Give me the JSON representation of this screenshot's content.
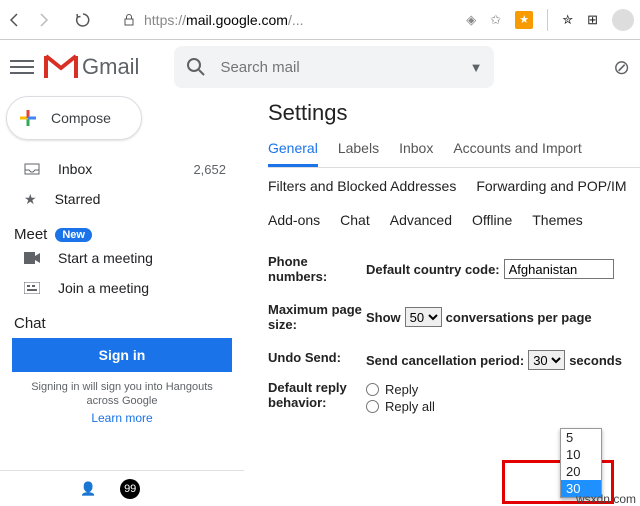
{
  "browser": {
    "url_prefix": "https://",
    "url_main": "mail.google.com",
    "url_suffix": "/..."
  },
  "header": {
    "logo": "Gmail",
    "search_placeholder": "Search mail"
  },
  "compose": {
    "label": "Compose"
  },
  "nav": {
    "inbox": "Inbox",
    "inbox_count": "2,652",
    "starred": "Starred"
  },
  "meet": {
    "title": "Meet",
    "badge": "New",
    "start": "Start a meeting",
    "join": "Join a meeting"
  },
  "chat": {
    "title": "Chat",
    "signin": "Sign in",
    "hint": "Signing in will sign you into Hangouts across Google",
    "learn": "Learn more"
  },
  "settings": {
    "title": "Settings",
    "tabs1": {
      "general": "General",
      "labels": "Labels",
      "inbox": "Inbox",
      "accounts": "Accounts and Import"
    },
    "tabs2": {
      "filters": "Filters and Blocked Addresses",
      "fwd": "Forwarding and POP/IM"
    },
    "tabs3": {
      "addons": "Add-ons",
      "chat": "Chat",
      "adv": "Advanced",
      "offline": "Offline",
      "themes": "Themes"
    },
    "phone": {
      "label": "Phone numbers:",
      "pre": "Default country code:",
      "value": "Afghanistan"
    },
    "page": {
      "label": "Maximum page size:",
      "pre": "Show",
      "value": "50",
      "post": "conversations per page"
    },
    "undo": {
      "label": "Undo Send:",
      "pre": "Send cancellation period:",
      "value": "30",
      "post": "seconds"
    },
    "reply": {
      "label": "Default reply behavior:",
      "r1": "Reply",
      "r2": "Reply all"
    }
  },
  "dropdown": {
    "o1": "5",
    "o2": "10",
    "o3": "20",
    "o4": "30"
  },
  "watermark": "wsxdn.com"
}
